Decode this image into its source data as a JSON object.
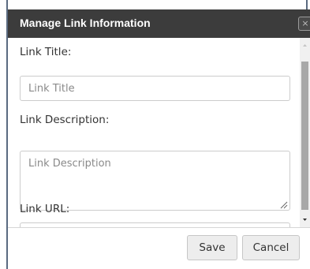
{
  "dialog": {
    "title": "Manage Link Information",
    "close_glyph": "×"
  },
  "form": {
    "title_label": "Link Title:",
    "title_placeholder": "Link Title",
    "description_label": "Link Description:",
    "description_placeholder": "Link Description",
    "url_label": "Link URL:"
  },
  "footer": {
    "save_label": "Save",
    "cancel_label": "Cancel"
  },
  "icons": {
    "close": "close-icon",
    "scroll_up": "triangle-up-icon",
    "scroll_down": "triangle-down-icon",
    "resize": "resize-grip-icon"
  }
}
